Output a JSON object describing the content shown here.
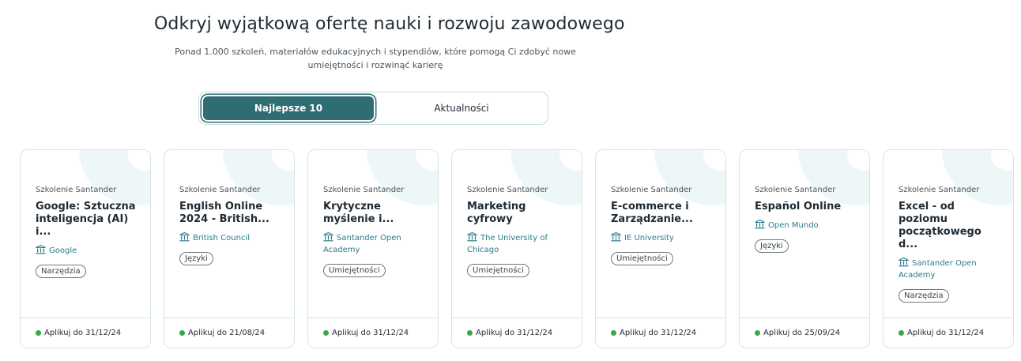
{
  "hero": {
    "title": "Odkryj wyjątkową ofertę nauki i rozwoju zawodowego",
    "subtitle": "Ponad 1.000 szkoleń, materiałów edukacyjnych i stypendiów, które pomogą Ci zdobyć nowe umiejętności i rozwinąć karierę"
  },
  "tabs": [
    {
      "label": "Najlepsze 10",
      "active": true
    },
    {
      "label": "Aktualności",
      "active": false
    }
  ],
  "colors": {
    "accent": "#2e6e73",
    "link": "#2c7a8a",
    "status_dot": "#39a845",
    "card_border": "#d3e4ea"
  },
  "cards": [
    {
      "org": "Szkolenie Santander",
      "title": "Google: Sztuczna inteligencja (AI) i...",
      "provider": "Google",
      "tag": "Narzędzia",
      "deadline": "Aplikuj do 31/12/24",
      "icon": "institution-icon"
    },
    {
      "org": "Szkolenie Santander",
      "title": "English Online 2024 - British...",
      "provider": "British Council",
      "tag": "Języki",
      "deadline": "Aplikuj do 21/08/24",
      "icon": "institution-icon"
    },
    {
      "org": "Szkolenie Santander",
      "title": "Krytyczne myślenie i...",
      "provider": "Santander Open Academy",
      "tag": "Umiejętności",
      "deadline": "Aplikuj do 31/12/24",
      "icon": "institution-icon"
    },
    {
      "org": "Szkolenie Santander",
      "title": "Marketing cyfrowy",
      "provider": "The University of Chicago",
      "tag": "Umiejętności",
      "deadline": "Aplikuj do 31/12/24",
      "icon": "institution-icon"
    },
    {
      "org": "Szkolenie Santander",
      "title": "E-commerce i Zarządzanie...",
      "provider": "IE University",
      "tag": "Umiejętności",
      "deadline": "Aplikuj do 31/12/24",
      "icon": "institution-icon"
    },
    {
      "org": "Szkolenie Santander",
      "title": "Español Online",
      "provider": "Open Mundo",
      "tag": "Języki",
      "deadline": "Aplikuj do 25/09/24",
      "icon": "institution-icon"
    },
    {
      "org": "Szkolenie Santander",
      "title": "Excel - od poziomu początkowego d...",
      "provider": "Santander Open Academy",
      "tag": "Narzędzia",
      "deadline": "Aplikuj do 31/12/24",
      "icon": "institution-icon"
    }
  ]
}
